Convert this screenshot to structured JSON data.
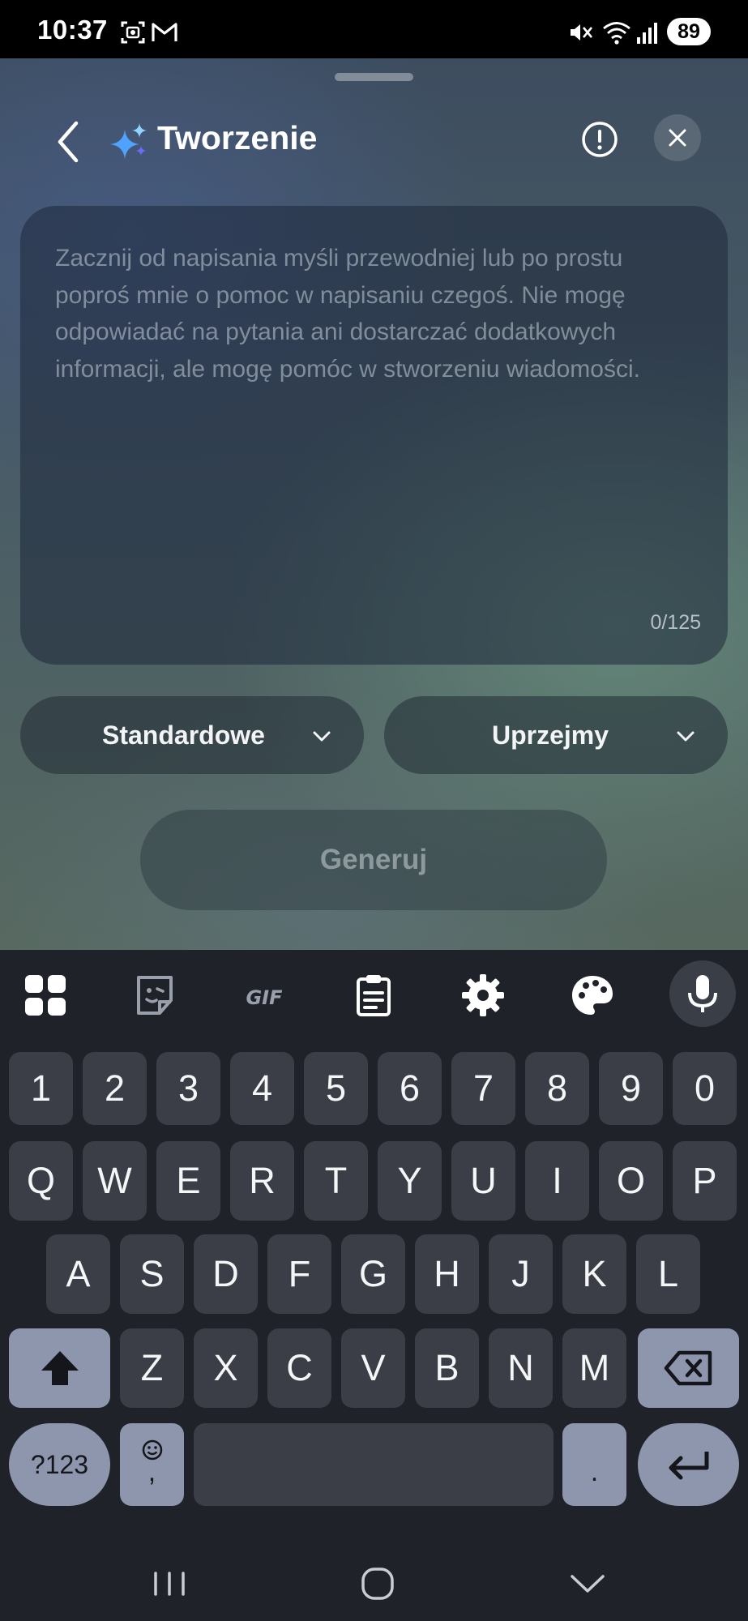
{
  "status_bar": {
    "time": "10:37",
    "battery": "89"
  },
  "panel": {
    "title": "Tworzenie",
    "prompt": {
      "placeholder": "Zacznij od napisania myśli przewodniej lub po prostu poproś mnie o pomoc w napisaniu czegoś. Nie mogę odpowiadać na pytania ani dostarczać dodatkowych informacji, ale mogę pomóc w stworzeniu wiadomości.",
      "char_count": "0/125"
    },
    "length_dropdown": {
      "label": "Standardowe"
    },
    "tone_dropdown": {
      "label": "Uprzejmy"
    },
    "generate_button": "Generuj",
    "accent_colors": [
      "#4fa3ff",
      "#8fd3ff",
      "#6a6cf5"
    ]
  },
  "keyboard": {
    "toolbar": [
      "apps-grid-icon",
      "sticker-icon",
      "gif-icon",
      "clipboard-icon",
      "settings-gear-icon",
      "palette-icon",
      "microphone-icon"
    ],
    "gif_label": "GIF",
    "rows": {
      "numbers": [
        "1",
        "2",
        "3",
        "4",
        "5",
        "6",
        "7",
        "8",
        "9",
        "0"
      ],
      "row1": [
        "Q",
        "W",
        "E",
        "R",
        "T",
        "Y",
        "U",
        "I",
        "O",
        "P"
      ],
      "row2": [
        "A",
        "S",
        "D",
        "F",
        "G",
        "H",
        "J",
        "K",
        "L"
      ],
      "row3": [
        "Z",
        "X",
        "C",
        "V",
        "B",
        "N",
        "M"
      ]
    },
    "symbols_key": "?123",
    "comma_key": ",",
    "period_key": ".",
    "key_color": "#3b3e46",
    "special_key_color": "#8e96ad"
  },
  "nav_bar": [
    "recent-apps-icon",
    "home-icon",
    "back-chevron-icon"
  ]
}
